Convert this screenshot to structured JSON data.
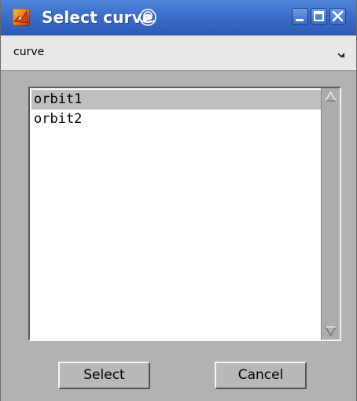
{
  "window": {
    "title": "Select curve",
    "icons": {
      "app": "matlab-logo-icon",
      "sticky": "sticky-pin-icon",
      "minimize": "minimize-icon",
      "maximize": "maximize-icon",
      "close": "close-icon"
    },
    "title_bar_color": "#3b6fcb"
  },
  "menubar": {
    "label": "curve",
    "corner_icon": "resize-corner-icon"
  },
  "list": {
    "items": [
      {
        "label": "orbit1",
        "selected": true
      },
      {
        "label": "orbit2",
        "selected": false
      }
    ],
    "scroll_up_icon": "scroll-up-arrow-icon",
    "scroll_down_icon": "scroll-down-arrow-icon"
  },
  "buttons": {
    "select_label": "Select",
    "cancel_label": "Cancel"
  }
}
